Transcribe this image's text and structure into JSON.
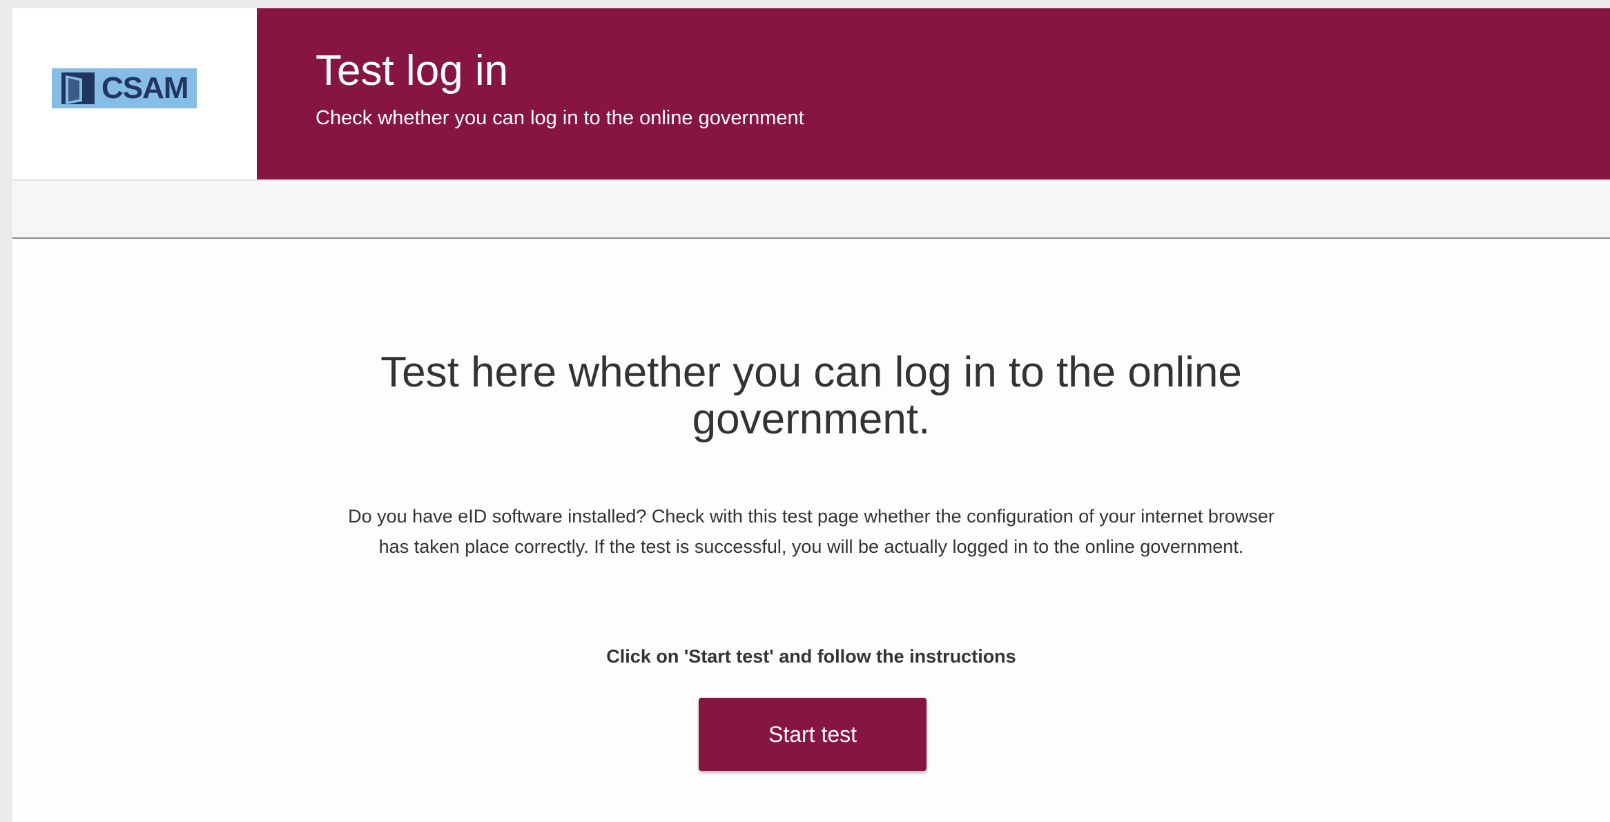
{
  "logo": {
    "text": "CSAM",
    "icon": "door-icon",
    "background_color": "#85bde6"
  },
  "header": {
    "title": "Test log in",
    "subtitle": "Check whether you can log in to the online government",
    "background_color": "#861641"
  },
  "main": {
    "heading": "Test here whether you can log in to the online government.",
    "description": "Do you have eID software installed? Check with this test page whether the configuration of your internet browser has taken place correctly. If the test is successful, you will be actually logged in to the online government.",
    "instruction": "Click on 'Start test' and follow the instructions",
    "start_button_label": "Start test"
  }
}
